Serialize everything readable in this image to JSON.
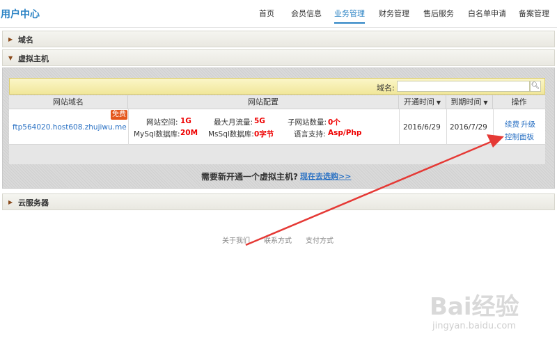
{
  "header": {
    "brand": "用户中心",
    "nav": [
      "首页",
      "会员信息",
      "业务管理",
      "财务管理",
      "售后服务",
      "白名单申请",
      "备案管理"
    ],
    "active_nav": "业务管理",
    "accent_color": "#2b83c4"
  },
  "panels": {
    "domain": {
      "title": "域名",
      "icon": "triangle-right-icon"
    },
    "virtual_host": {
      "title": "虚拟主机",
      "icon": "triangle-down-icon"
    },
    "cloud_server": {
      "title": "云服务器",
      "icon": "triangle-right-icon"
    }
  },
  "search": {
    "label": "域名:",
    "value": "",
    "placeholder": "",
    "icon": "search-icon"
  },
  "table": {
    "headers": {
      "domain": "网站域名",
      "config": "网站配置",
      "open_time": "开通时间",
      "expire_time": "到期时间",
      "actions": "操作"
    },
    "rows": [
      {
        "domain": "ftp564020.host608.zhujiwu.me",
        "badge": "免费",
        "config": {
          "space_label": "网站空间:",
          "space_value": "1G",
          "traffic_label": "最大月流量:",
          "traffic_value": "5G",
          "subsite_label": "子网站数量:",
          "subsite_value": "0个",
          "mysql_label": "MySql数据库:",
          "mysql_value": "20M",
          "mssql_label": "MsSql数据库:",
          "mssql_value": "0字节",
          "lang_label": "语言支持:",
          "lang_value": "Asp/Php"
        },
        "open_time": "2016/6/29",
        "expire_time": "2016/7/29",
        "actions": {
          "renew": "续费",
          "upgrade": "升级",
          "control_panel": "控制面板"
        }
      }
    ]
  },
  "prompt": {
    "text": "需要新开通一个虚拟主机?",
    "link": "现在去选购>>"
  },
  "footer": {
    "links": [
      "关于我们",
      "联系方式",
      "支付方式"
    ]
  },
  "watermark": {
    "main": "Bai经验",
    "sub": "jingyan.baidu.com"
  },
  "colors": {
    "link": "#2b72c4",
    "value_red": "#e00000",
    "badge": "#e4571c",
    "annotation_arrow": "#e53935"
  }
}
